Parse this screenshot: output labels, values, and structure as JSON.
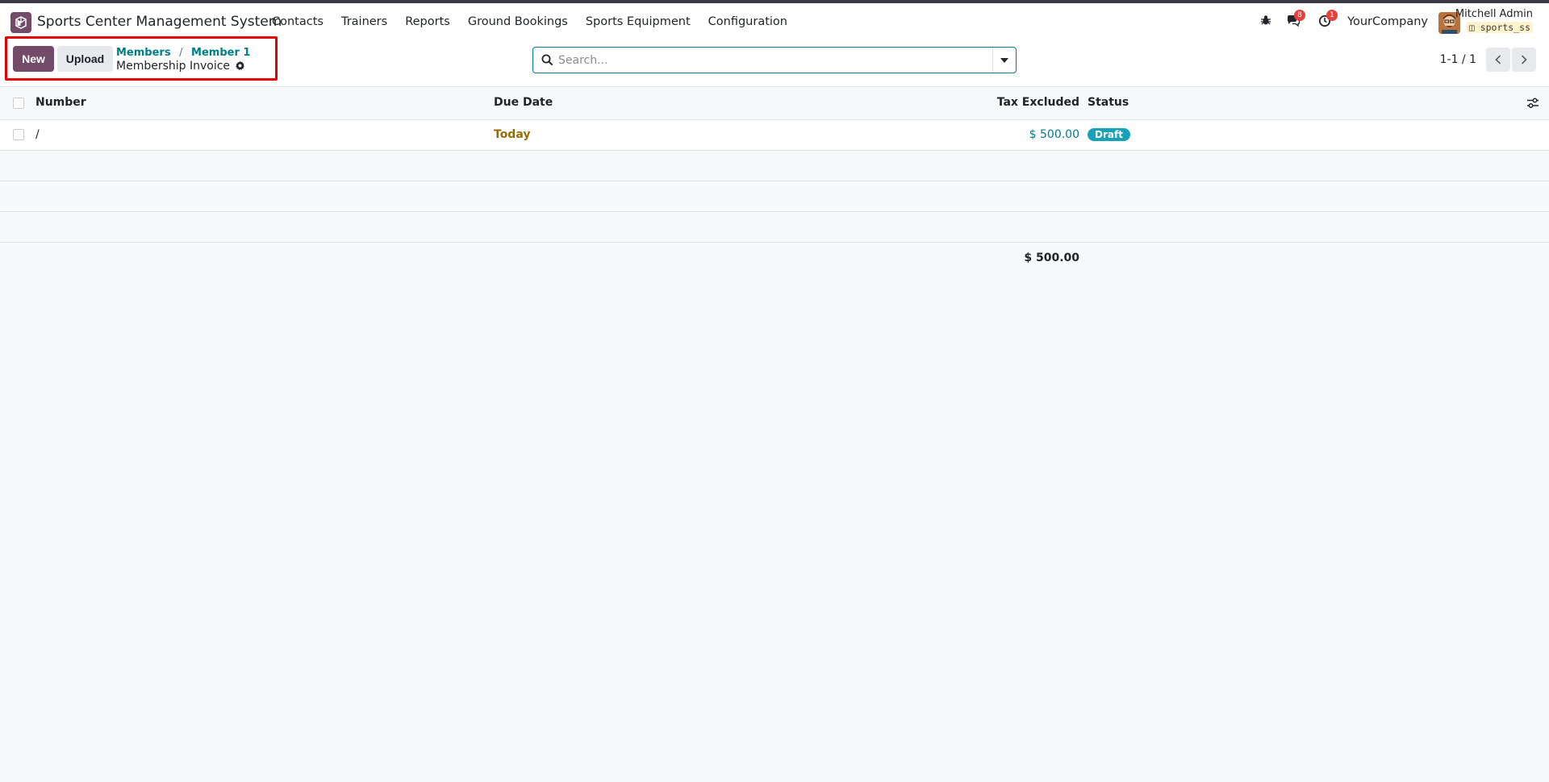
{
  "app": {
    "name": "Sports Center Management System",
    "brand_color": "#714b67"
  },
  "navbar": {
    "menu": [
      "Contacts",
      "Trainers",
      "Reports",
      "Ground Bookings",
      "Sports Equipment",
      "Configuration"
    ],
    "messages_count": "8",
    "activities_count": "1",
    "company": "YourCompany",
    "user_name": "Mitchell Admin",
    "database": "sports_ss"
  },
  "control": {
    "new_label": "New",
    "upload_label": "Upload",
    "breadcrumb": [
      "Members",
      "Member 1"
    ],
    "page_title": "Membership Invoice",
    "search_placeholder": "Search...",
    "pager": "1-1 / 1"
  },
  "table": {
    "columns": {
      "number": "Number",
      "due_date": "Due Date",
      "tax_excluded": "Tax Excluded",
      "status": "Status"
    },
    "rows": [
      {
        "number": "/",
        "due_date": "Today",
        "tax_excluded": "$ 500.00",
        "status": "Draft"
      }
    ],
    "total": "$ 500.00"
  }
}
